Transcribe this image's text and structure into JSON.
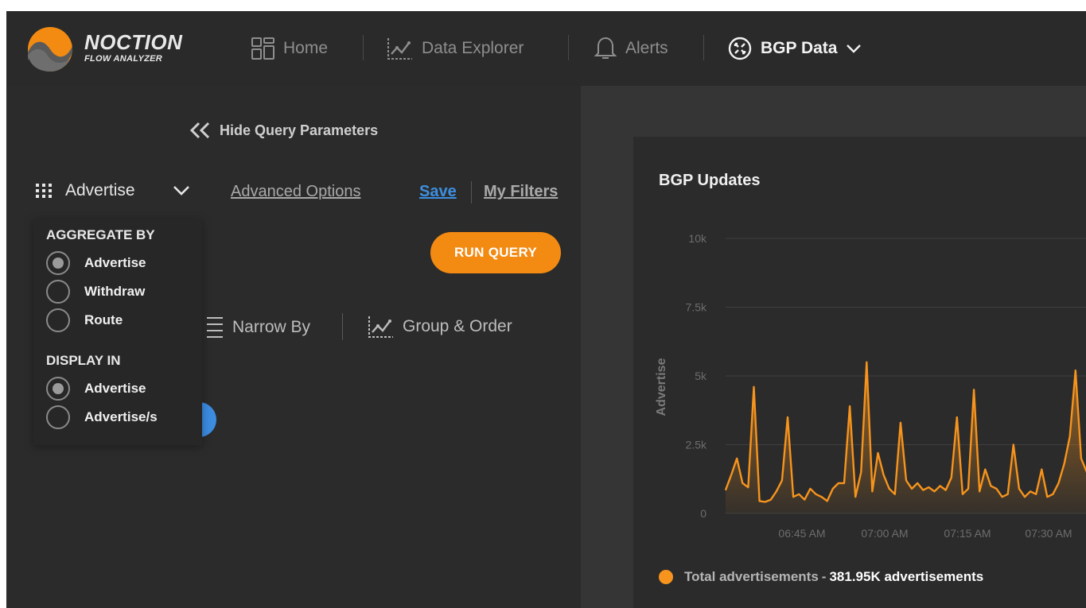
{
  "brand": {
    "name": "NOCTION",
    "sub": "FLOW ANALYZER"
  },
  "nav": {
    "home": "Home",
    "data_explorer": "Data Explorer",
    "alerts": "Alerts",
    "bgp_data": "BGP Data"
  },
  "panel": {
    "hide_query": "Hide Query Parameters",
    "metric": "Advertise",
    "advanced_options": "Advanced Options",
    "save": "Save",
    "my_filters": "My Filters",
    "run_query": "RUN QUERY",
    "narrow_by": "Narrow By",
    "group_order": "Group & Order"
  },
  "dropdown": {
    "aggregate_by": "AGGREGATE BY",
    "aggregate_options": [
      {
        "label": "Advertise",
        "checked": true
      },
      {
        "label": "Withdraw",
        "checked": false
      },
      {
        "label": "Route",
        "checked": false
      }
    ],
    "display_in": "DISPLAY IN",
    "display_options": [
      {
        "label": "Advertise",
        "checked": true
      },
      {
        "label": "Advertise/s",
        "checked": false
      }
    ]
  },
  "colors": {
    "accent": "#f38a12",
    "link": "#3d8fe0",
    "series": "#f7941d"
  },
  "chart_data": {
    "type": "area",
    "title": "BGP Updates",
    "ylabel": "Advertise",
    "ylim": [
      0,
      10000
    ],
    "yticks": [
      "0",
      "2.5k",
      "5k",
      "7.5k",
      "10k"
    ],
    "xticks": [
      "06:45 AM",
      "07:00 AM",
      "07:15 AM",
      "07:30 AM"
    ],
    "grid": true,
    "series": [
      {
        "name": "Total advertisements",
        "values": [
          850,
          1400,
          2000,
          1100,
          950,
          4600,
          450,
          420,
          500,
          800,
          1200,
          3500,
          600,
          700,
          500,
          900,
          700,
          600,
          450,
          900,
          1100,
          1100,
          3900,
          600,
          1500,
          5500,
          800,
          2200,
          1400,
          900,
          700,
          3300,
          1200,
          900,
          1100,
          850,
          950,
          800,
          1000,
          850,
          1300,
          3500,
          700,
          900,
          4500,
          800,
          1600,
          1000,
          900,
          600,
          700,
          2500,
          900,
          600,
          800,
          700,
          1600,
          600,
          700,
          1100,
          1800,
          2800,
          5200,
          2000,
          1500
        ]
      }
    ],
    "legend": {
      "name": "Total advertisements",
      "value": "381.95K advertisements",
      "position": "bottom-left"
    }
  }
}
